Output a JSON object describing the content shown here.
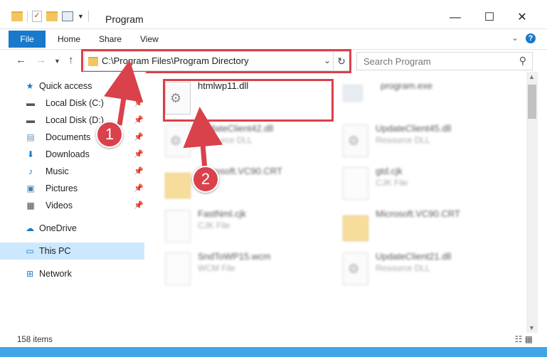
{
  "window": {
    "title": "Program",
    "minimize": "—",
    "maximize": "☐",
    "close": "✕"
  },
  "ribbon": {
    "file": "File",
    "tabs": [
      "Home",
      "Share",
      "View"
    ],
    "help": "?"
  },
  "address": {
    "path": "C:\\Program Files\\Program Directory"
  },
  "search": {
    "placeholder": "Search Program"
  },
  "nav": {
    "quick_access": "Quick access",
    "items": [
      {
        "label": "Local Disk (C:)",
        "icon": "drive-icon"
      },
      {
        "label": "Local Disk (D:)",
        "icon": "drive-icon"
      },
      {
        "label": "Documents",
        "icon": "documents-icon"
      },
      {
        "label": "Downloads",
        "icon": "downloads-icon"
      },
      {
        "label": "Music",
        "icon": "music-icon"
      },
      {
        "label": "Pictures",
        "icon": "pictures-icon"
      },
      {
        "label": "Videos",
        "icon": "videos-icon"
      }
    ],
    "onedrive": "OneDrive",
    "this_pc": "This PC",
    "network": "Network"
  },
  "files": [
    {
      "name": "htmlwp11.dll",
      "type": "",
      "icon": "dll-gear-icon"
    },
    {
      "name": "program.exe",
      "type": "",
      "icon": "exe-icon"
    },
    {
      "name": "UpdateClient42.dll",
      "type": "Resource DLL",
      "icon": "dll-gear-icon"
    },
    {
      "name": "UpdateClient45.dll",
      "type": "Resource DLL",
      "icon": "dll-gear-icon"
    },
    {
      "name": "Microsoft.VC90.CRT",
      "type": "",
      "icon": "folder-icon"
    },
    {
      "name": "gtd.cjk",
      "type": "CJK File",
      "icon": "file-icon"
    },
    {
      "name": "FastNml.cjk",
      "type": "CJK File",
      "icon": "file-icon"
    },
    {
      "name": "Microsoft.VC90.CRT",
      "type": "",
      "icon": "folder-icon"
    },
    {
      "name": "SndToWP15.wcm",
      "type": "WCM File",
      "icon": "file-icon"
    },
    {
      "name": "UpdateClient21.dll",
      "type": "Resource DLL",
      "icon": "dll-gear-icon"
    }
  ],
  "status": {
    "count": "158 items"
  },
  "callouts": [
    "1",
    "2"
  ],
  "colors": {
    "accent": "#1979ca",
    "highlight": "#d9414b",
    "selected": "#cce8ff"
  }
}
